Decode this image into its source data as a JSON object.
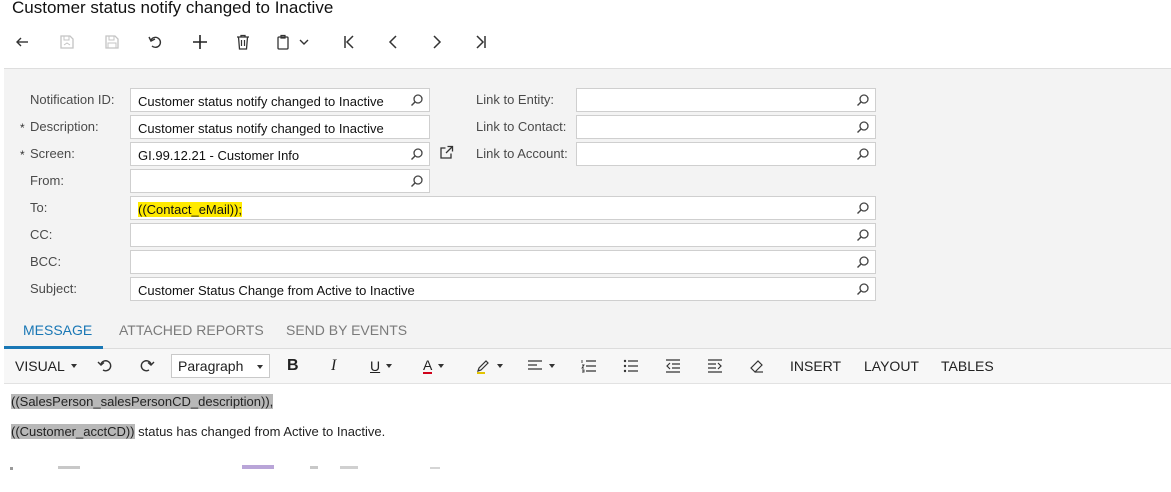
{
  "page": {
    "title": "Customer status notify changed to Inactive"
  },
  "toolbar": {
    "buttons": [
      {
        "name": "back-icon"
      },
      {
        "name": "save-close-icon"
      },
      {
        "name": "save-icon"
      },
      {
        "name": "undo-icon"
      },
      {
        "name": "add-icon"
      },
      {
        "name": "delete-icon"
      },
      {
        "name": "copy-paste-icon"
      },
      {
        "name": "first-record-icon"
      },
      {
        "name": "previous-record-icon"
      },
      {
        "name": "next-record-icon"
      },
      {
        "name": "last-record-icon"
      }
    ]
  },
  "form": {
    "notification_id": {
      "label": "Notification ID:",
      "value": "Customer status notify changed to Inactive"
    },
    "description": {
      "label": "Description:",
      "required": "*",
      "value": "Customer status notify changed to Inactive"
    },
    "screen": {
      "label": "Screen:",
      "required": "*",
      "value": "GI.99.12.21 - Customer Info"
    },
    "from": {
      "label": "From:",
      "value": ""
    },
    "to": {
      "label": "To:",
      "value": "((Contact_eMail));"
    },
    "cc": {
      "label": "CC:",
      "value": ""
    },
    "bcc": {
      "label": "BCC:",
      "value": ""
    },
    "subject": {
      "label": "Subject:",
      "value": "Customer Status Change from Active to Inactive"
    },
    "link_to_entity": {
      "label": "Link to Entity:",
      "value": ""
    },
    "link_to_contact": {
      "label": "Link to Contact:",
      "value": ""
    },
    "link_to_account": {
      "label": "Link to Account:",
      "value": ""
    }
  },
  "tabs": [
    {
      "label": "MESSAGE",
      "active": true
    },
    {
      "label": "ATTACHED REPORTS",
      "active": false
    },
    {
      "label": "SEND BY EVENTS",
      "active": false
    }
  ],
  "editor": {
    "mode": "VISUAL",
    "paragraph_style": "Paragraph",
    "bold": "B",
    "italic": "I",
    "underline": "U",
    "font_color": "A",
    "insert": "INSERT",
    "layout": "LAYOUT",
    "tables": "TABLES"
  },
  "message": {
    "line1_placeholder": "((SalesPerson_salesPersonCD_description)),",
    "line2_placeholder": "((Customer_acctCD))",
    "line2_text": " status has changed from Active to Inactive."
  },
  "colors": {
    "accent": "#1977b5",
    "to_highlight": "#ffea00",
    "placeholder_highlight": "#b8b8b8",
    "form_background": "#f3f3f3"
  }
}
